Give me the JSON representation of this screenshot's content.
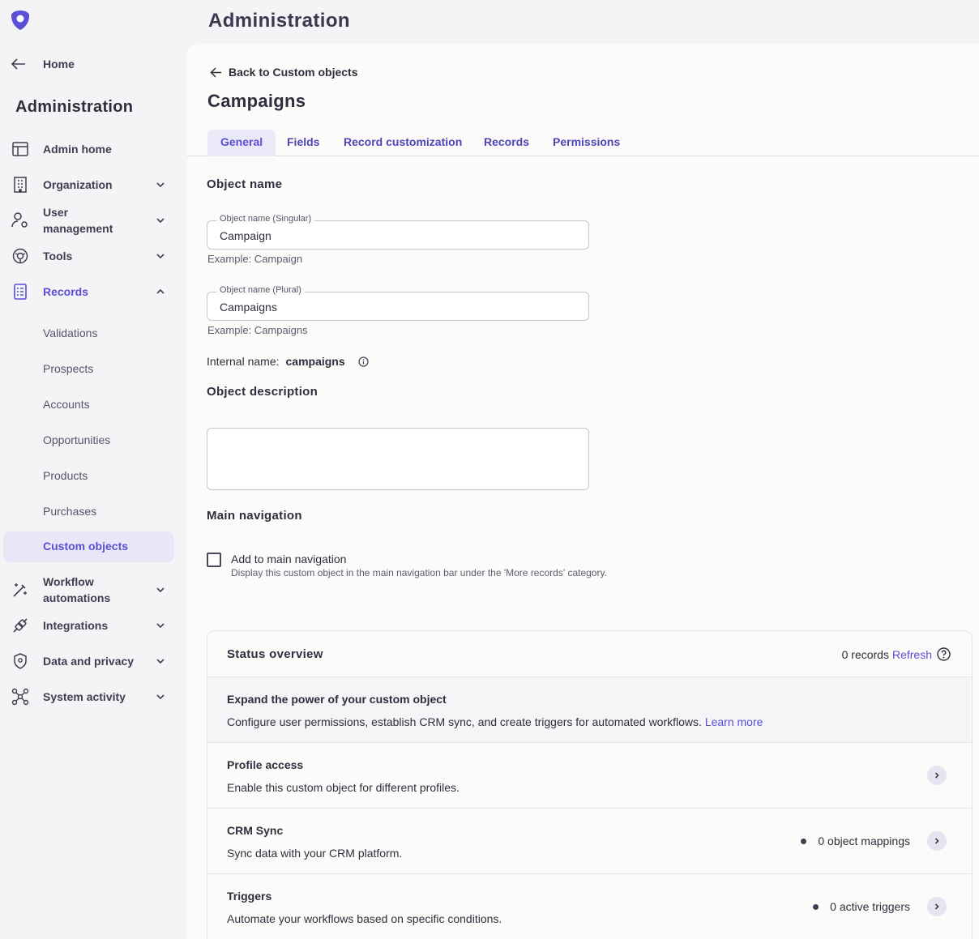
{
  "app": {
    "header_title": "Administration"
  },
  "sidebar": {
    "home_label": "Home",
    "title": "Administration",
    "items": [
      {
        "label": "Admin home",
        "icon": "layout-icon"
      },
      {
        "label": "Organization",
        "icon": "building-icon"
      },
      {
        "label": "User management",
        "icon": "user-gear-icon"
      },
      {
        "label": "Tools",
        "icon": "tools-icon"
      },
      {
        "label": "Records",
        "icon": "records-icon"
      },
      {
        "label": "Workflow automations",
        "icon": "magic-wand-icon"
      },
      {
        "label": "Integrations",
        "icon": "plug-icon"
      },
      {
        "label": "Data and privacy",
        "icon": "shield-icon"
      },
      {
        "label": "System activity",
        "icon": "network-icon"
      }
    ],
    "records_sub": [
      "Validations",
      "Prospects",
      "Accounts",
      "Opportunities",
      "Products",
      "Purchases",
      "Custom objects"
    ]
  },
  "main": {
    "back_label": "Back to Custom objects",
    "title": "Campaigns",
    "tabs": [
      "General",
      "Fields",
      "Record customization",
      "Records",
      "Permissions"
    ],
    "object_name": {
      "heading": "Object name",
      "singular_label": "Object name (Singular)",
      "singular_value": "Campaign",
      "singular_help": "Example: Campaign",
      "plural_label": "Object name (Plural)",
      "plural_value": "Campaigns",
      "plural_help": "Example: Campaigns",
      "internal_label": "Internal name:",
      "internal_value": "campaigns"
    },
    "description_heading": "Object description",
    "navigation": {
      "heading": "Main navigation",
      "checkbox_label": "Add to main navigation",
      "checkbox_desc": "Display this custom object in the main navigation bar under the 'More records' category."
    },
    "status": {
      "heading": "Status overview",
      "records_count": "0 records",
      "refresh_label": "Refresh",
      "promo_title": "Expand the power of your custom object",
      "promo_desc": "Configure user permissions, establish CRM sync, and create triggers for automated workflows.",
      "promo_link": "Learn more",
      "rows": [
        {
          "title": "Profile access",
          "desc": "Enable this custom object for different profiles.",
          "stat": ""
        },
        {
          "title": "CRM Sync",
          "desc": "Sync data with your CRM platform.",
          "stat": "0 object mappings"
        },
        {
          "title": "Triggers",
          "desc": "Automate your workflows based on specific conditions.",
          "stat": "0 active triggers"
        }
      ]
    }
  },
  "colors": {
    "accent": "#5a4fd6",
    "text": "#2f2e3e",
    "sidebar_bg": "#f4f3f5",
    "panel_bg": "#fcfbf9"
  }
}
